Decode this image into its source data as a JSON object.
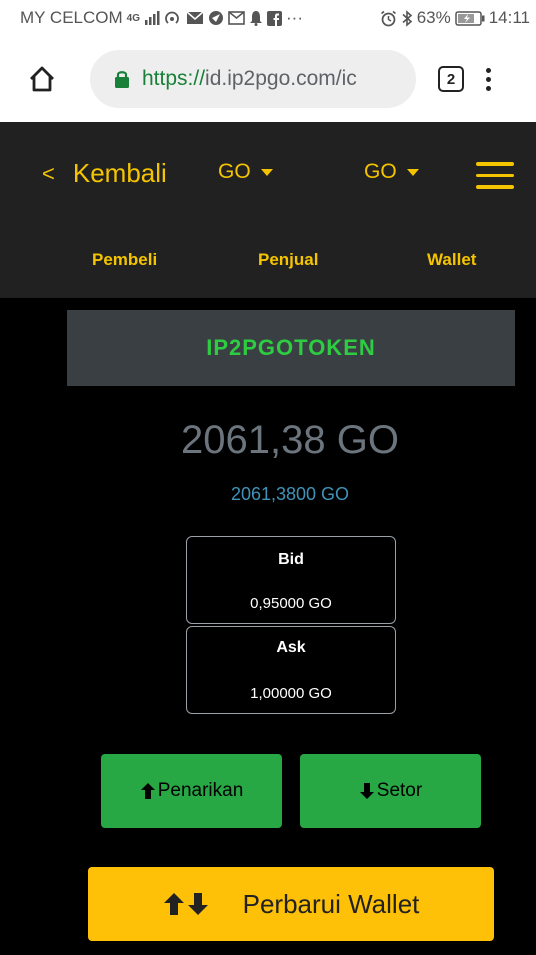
{
  "status_bar": {
    "carrier": "MY CELCOM",
    "network": "4G",
    "more_icons": "···",
    "battery": "63%",
    "time": "14:11"
  },
  "browser": {
    "url_scheme": "https://",
    "url_rest": "id.ip2pgo.com/ic",
    "tab_count": "2"
  },
  "header": {
    "back_label": "Kembali",
    "dropdown_1": "GO",
    "dropdown_2": "GO",
    "sub_nav": [
      "Pembeli",
      "Penjual",
      "Wallet"
    ],
    "accent_color": "#f5c400"
  },
  "wallet": {
    "token_name": "IP2PGOTOKEN",
    "balance": "2061,38 GO",
    "balance_precise": "2061,3800 GO",
    "bid_label": "Bid",
    "bid_value": "0,95000 GO",
    "ask_label": "Ask",
    "ask_value": "1,00000 GO"
  },
  "actions": {
    "withdraw_label": "Penarikan",
    "deposit_label": "Setor",
    "refresh_label": "Perbarui Wallet",
    "green": "#28a745",
    "yellow": "#ffc107"
  }
}
